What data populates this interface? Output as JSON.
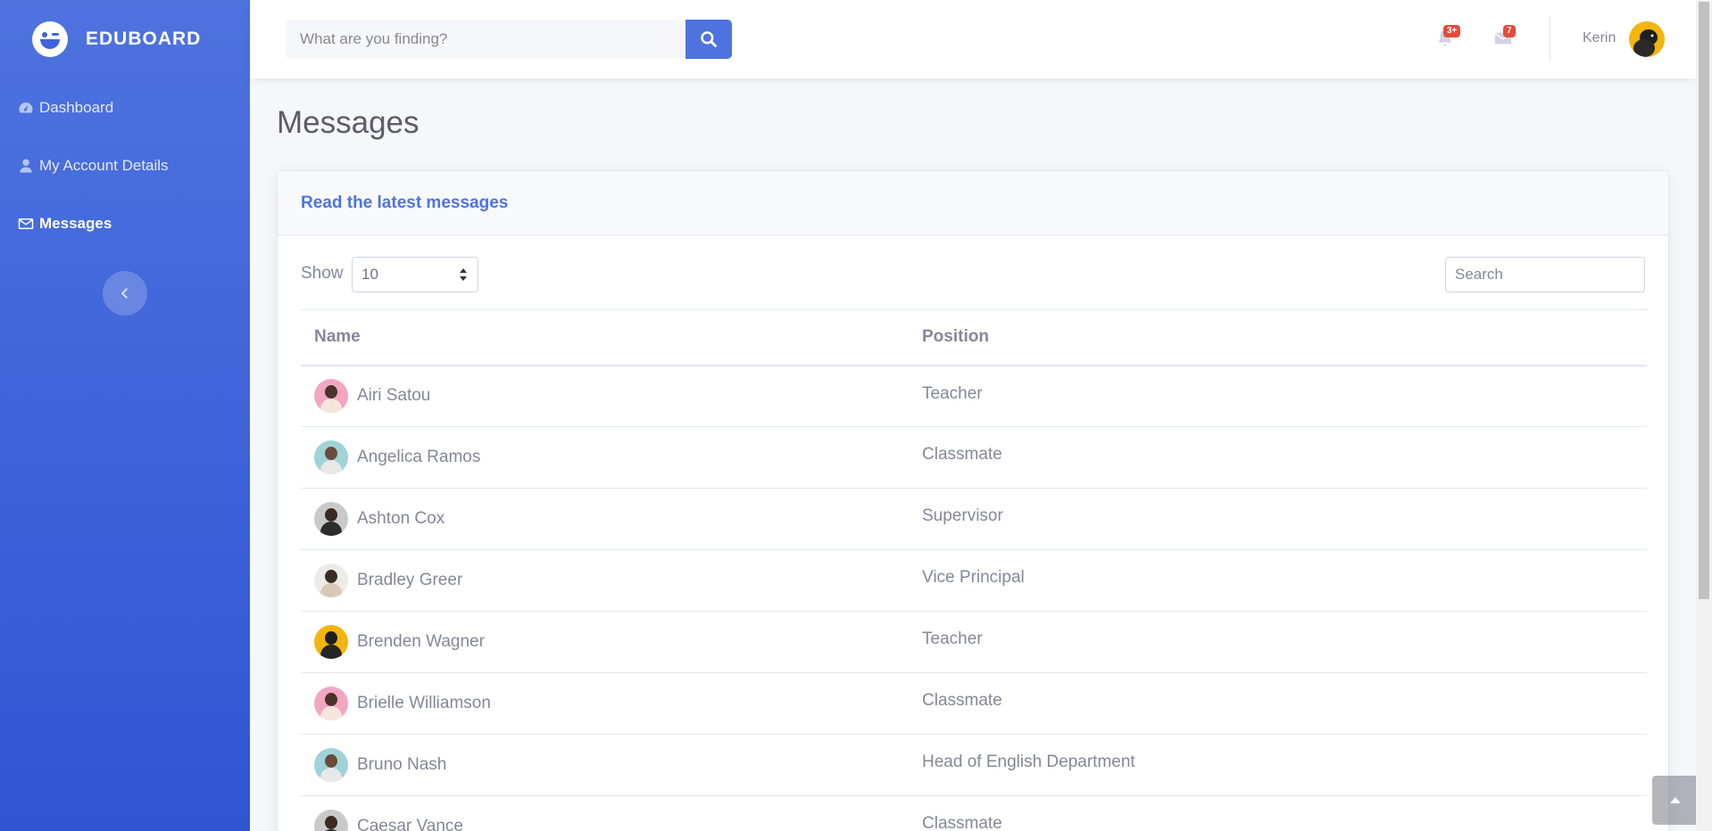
{
  "brand": {
    "name": "EDUBOARD",
    "logo_icon": "wink-face-icon"
  },
  "sidebar": {
    "items": [
      {
        "label": "Dashboard",
        "icon": "dashboard-gauge-icon",
        "active": false
      },
      {
        "label": "My Account Details",
        "icon": "user-icon",
        "active": false
      },
      {
        "label": "Messages",
        "icon": "envelope-icon",
        "active": true
      }
    ],
    "collapse_icon": "chevron-left-icon"
  },
  "topbar": {
    "search_placeholder": "What are you finding?",
    "search_icon": "search-icon",
    "alerts_badge": "3+",
    "messages_badge": "7",
    "user_name": "Kerin"
  },
  "page": {
    "title": "Messages"
  },
  "card": {
    "title": "Read the latest messages",
    "show_label": "Show",
    "page_length": "10",
    "search_placeholder": "Search",
    "columns": [
      "Name",
      "Position"
    ],
    "rows": [
      {
        "name": "Airi Satou",
        "position": "Teacher",
        "avatar": "pink"
      },
      {
        "name": "Angelica Ramos",
        "position": "Classmate",
        "avatar": "teal"
      },
      {
        "name": "Ashton Cox",
        "position": "Supervisor",
        "avatar": "grey"
      },
      {
        "name": "Bradley Greer",
        "position": "Vice Principal",
        "avatar": "light"
      },
      {
        "name": "Brenden Wagner",
        "position": "Teacher",
        "avatar": "yellow"
      },
      {
        "name": "Brielle Williamson",
        "position": "Classmate",
        "avatar": "pink"
      },
      {
        "name": "Bruno Nash",
        "position": "Head of English Department",
        "avatar": "teal"
      },
      {
        "name": "Caesar Vance",
        "position": "Classmate",
        "avatar": "grey"
      }
    ]
  },
  "colors": {
    "primary": "#4e73df",
    "badge": "#e74a3b",
    "text_muted": "#858796"
  }
}
